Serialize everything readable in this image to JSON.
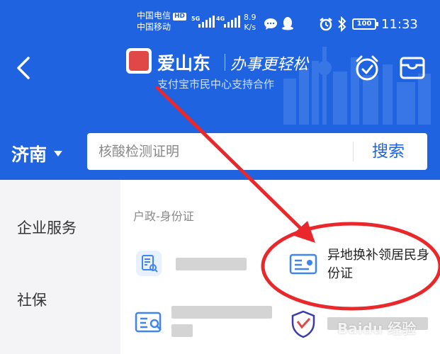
{
  "status_bar": {
    "carrier_1": "中国电信",
    "carrier_1_badge": "HD",
    "carrier_2": "中国移动",
    "net_1": "5G",
    "net_2": "4G",
    "speed_value": "8.9",
    "speed_unit": "K/s",
    "battery": "100",
    "time": "11:33"
  },
  "header": {
    "brand": "爱山东",
    "slogan": "办事更轻松",
    "partner_text": "支付宝市民中心支持合作",
    "back_icon": "chevron-left-icon",
    "timer_icon": "stopwatch-check-icon",
    "card_icon": "card-holder-icon"
  },
  "search": {
    "city": "济南",
    "placeholder": "核酸检测证明",
    "button_label": "搜索"
  },
  "sidebar": {
    "items": [
      {
        "label": "企业服务"
      },
      {
        "label": "社保"
      }
    ]
  },
  "main": {
    "section_title": "户政-身份证",
    "services": [
      {
        "label": "",
        "icon": "document-search-icon",
        "blurred": true
      },
      {
        "label": "异地换补领居民身份证",
        "icon": "id-card-icon",
        "blurred": false
      },
      {
        "label": "",
        "icon": "id-card-search-icon",
        "blurred": true
      },
      {
        "label": "",
        "icon": "police-shield-icon",
        "blurred": true
      }
    ]
  },
  "watermark": "Baidu 经验",
  "colors": {
    "brand_blue": "#1f63e0",
    "annotation_red": "#e8282b",
    "sidebar_bg": "#f4f4f6"
  }
}
